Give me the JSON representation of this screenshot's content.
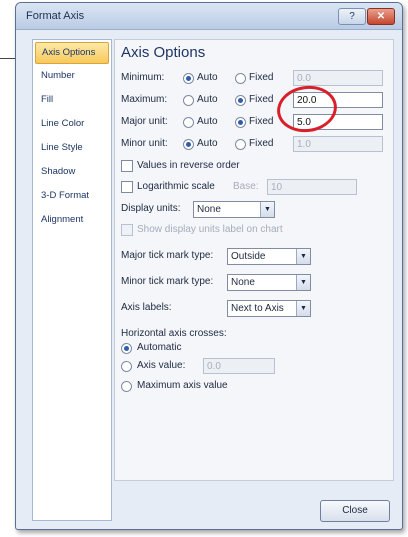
{
  "window": {
    "title": "Format Axis",
    "help_glyph": "?",
    "close_glyph": "✕"
  },
  "nav": {
    "items": [
      {
        "label": "Axis Options"
      },
      {
        "label": "Number"
      },
      {
        "label": "Fill"
      },
      {
        "label": "Line Color"
      },
      {
        "label": "Line Style"
      },
      {
        "label": "Shadow"
      },
      {
        "label": "3-D Format"
      },
      {
        "label": "Alignment"
      }
    ]
  },
  "panel": {
    "title": "Axis Options",
    "minimum": {
      "label": "Minimum:",
      "auto": "Auto",
      "fixed": "Fixed",
      "value": "0.0",
      "selected": "auto"
    },
    "maximum": {
      "label": "Maximum:",
      "auto": "Auto",
      "fixed": "Fixed",
      "value": "20.0",
      "selected": "fixed"
    },
    "major_unit": {
      "label": "Major unit:",
      "auto": "Auto",
      "fixed": "Fixed",
      "value": "5.0",
      "selected": "fixed"
    },
    "minor_unit": {
      "label": "Minor unit:",
      "auto": "Auto",
      "fixed": "Fixed",
      "value": "1.0",
      "selected": "auto"
    },
    "reverse_order": {
      "label": "Values in reverse order",
      "checked": false
    },
    "log_scale": {
      "label": "Logarithmic scale",
      "base_label": "Base:",
      "base_value": "10",
      "checked": false
    },
    "display_units": {
      "label": "Display units:",
      "value": "None"
    },
    "show_units_label": {
      "label": "Show display units label on chart",
      "checked": false
    },
    "major_tick": {
      "label": "Major tick mark type:",
      "value": "Outside"
    },
    "minor_tick": {
      "label": "Minor tick mark type:",
      "value": "None"
    },
    "axis_labels": {
      "label": "Axis labels:",
      "value": "Next to Axis"
    },
    "horizontal_crosses": {
      "label": "Horizontal axis crosses:",
      "automatic": "Automatic",
      "axis_value": "Axis value:",
      "axis_value_input": "0.0",
      "maximum": "Maximum axis value",
      "selected": "automatic"
    }
  },
  "footer": {
    "close_label": "Close"
  },
  "colors": {
    "highlight_circle": "#d8202a",
    "selected_nav": "#f7c95a"
  }
}
